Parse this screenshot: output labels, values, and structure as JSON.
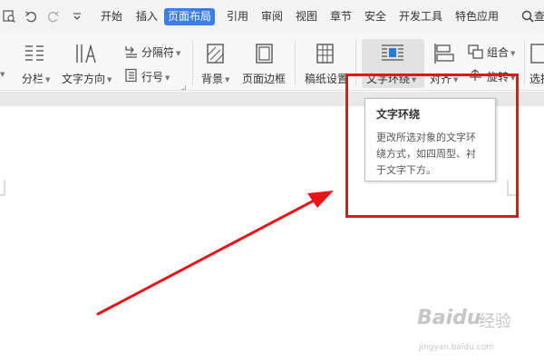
{
  "menubar": {
    "tabs": [
      {
        "label": "开始",
        "name": "menu-tab-start"
      },
      {
        "label": "插入",
        "name": "menu-tab-insert"
      },
      {
        "label": "页面布局",
        "name": "menu-tab-page-layout",
        "active": true
      },
      {
        "label": "引用",
        "name": "menu-tab-references"
      },
      {
        "label": "审阅",
        "name": "menu-tab-review"
      },
      {
        "label": "视图",
        "name": "menu-tab-view"
      },
      {
        "label": "章节",
        "name": "menu-tab-section"
      },
      {
        "label": "安全",
        "name": "menu-tab-security"
      },
      {
        "label": "开发工具",
        "name": "menu-tab-developer"
      },
      {
        "label": "特色应用",
        "name": "menu-tab-features"
      }
    ],
    "search_label": "查",
    "active_color": "#3c7ee4"
  },
  "ribbon": {
    "columns_label": "分栏",
    "text_direction_label": "文字方向",
    "separator_label": "分隔符",
    "line_number_label": "行号",
    "background_label": "背景",
    "page_border_label": "页面边框",
    "manuscript_label": "稿纸设置",
    "text_wrap_label": "文字环绕",
    "align_label": "对齐",
    "group_label": "组合",
    "rotate_label": "旋转",
    "select_label": "选择"
  },
  "tooltip": {
    "title": "文字环绕",
    "line1": "更改所选对象的文字环",
    "line2": "绕方式，如四周型、衬",
    "line3": "于文字下方。"
  },
  "watermark": {
    "brand": "Baidu",
    "brand_cn": "经验",
    "url": "jingyan.baidu.com"
  },
  "colors": {
    "highlight": "#e8141a",
    "ribbon_bg": "#f7f7f7",
    "menubar_bg": "#f3f3f3"
  }
}
